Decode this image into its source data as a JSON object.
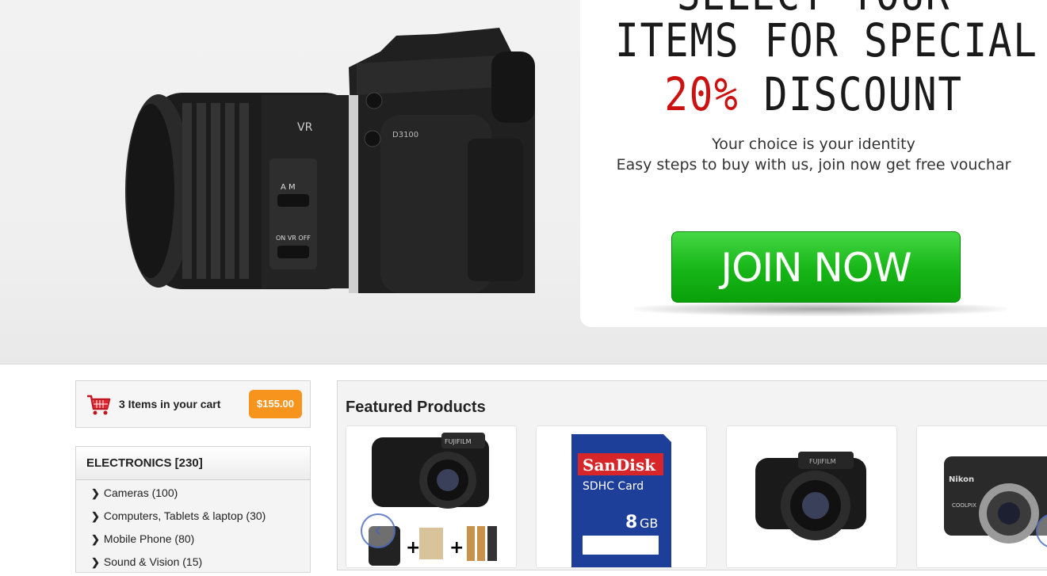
{
  "hero": {
    "promo_line1": "SELECT YOUR",
    "promo_line2": "ITEMS FOR SPECIAL",
    "promo_line3_highlight": "20%",
    "promo_line3_rest": " DISCOUNT",
    "tagline1": "Your choice is your identity",
    "tagline2": "Easy steps to buy with us, join now get free vouchar",
    "join_label": "JOIN NOW",
    "camera_lens_text": "VR",
    "camera_model_text": "D3100",
    "highlight_color": "#cc1111",
    "button_color": "#16b516"
  },
  "cart": {
    "items_text": "3 Items in your cart",
    "total": "$155.00",
    "total_color": "#f7941d"
  },
  "categories": {
    "header": "ELECTRONICS [230]",
    "items": [
      {
        "label": "Cameras (100)"
      },
      {
        "label": "Computers, Tablets & laptop (30)"
      },
      {
        "label": "Mobile Phone (80)"
      },
      {
        "label": "Sound & Vision (15)"
      }
    ]
  },
  "featured": {
    "title": "Featured Products",
    "products": [
      {
        "icon": "bridge-camera-bundle-image",
        "brand": "FUJIFILM"
      },
      {
        "icon": "sd-card-image",
        "brand": "SanDisk",
        "line1": "SDHC Card",
        "capacity": "8",
        "unit": "GB"
      },
      {
        "icon": "bridge-camera-image",
        "brand": "FUJIFILM"
      },
      {
        "icon": "compact-camera-image",
        "brand": "Nikon",
        "line1": "COOLPIX"
      }
    ]
  }
}
